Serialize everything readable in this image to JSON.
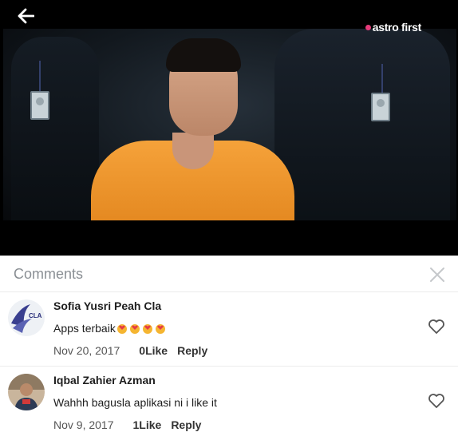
{
  "video": {
    "logo_text": "astro first",
    "logo_dot_color": "#e63b7a",
    "back_icon": "arrow-left-icon"
  },
  "comments_panel": {
    "title": "Comments",
    "close_icon": "close-icon",
    "items": [
      {
        "author": "Sofia Yusri Peah Cla",
        "avatar_text": "CLA",
        "text": "Apps terbaik",
        "emoji_count": 4,
        "date": "Nov 20, 2017",
        "likes": "0Like",
        "reply": "Reply",
        "like_icon": "heart-outline-icon"
      },
      {
        "author": "Iqbal Zahier Azman",
        "text": "Wahhh bagusla aplikasi ni i like it",
        "date": "Nov 9, 2017",
        "likes": "1Like",
        "reply": "Reply",
        "like_icon": "heart-outline-icon"
      }
    ]
  }
}
